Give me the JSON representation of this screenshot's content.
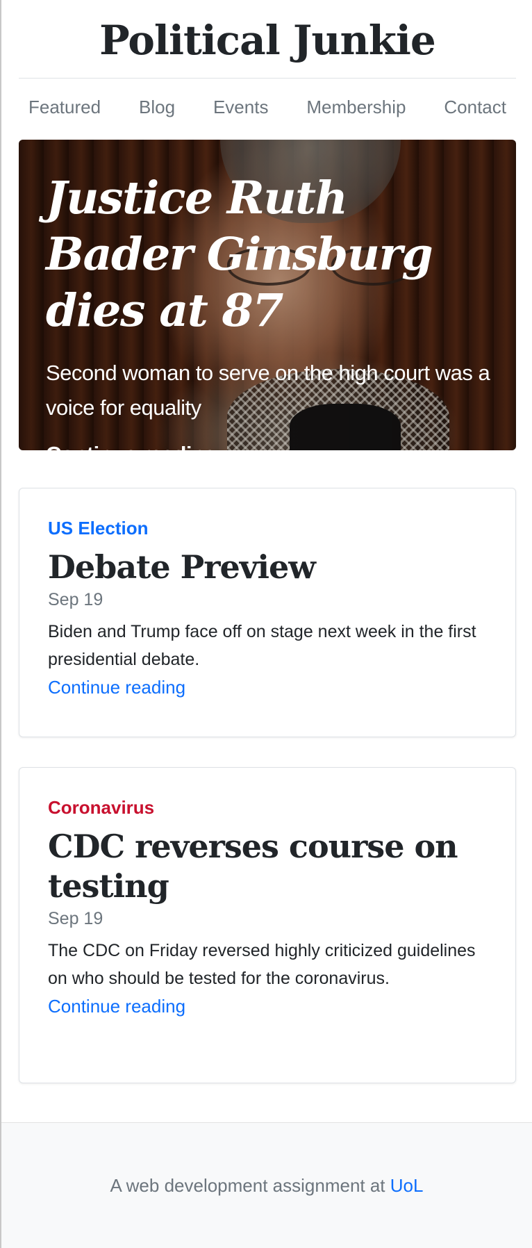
{
  "header": {
    "title": "Political Junkie"
  },
  "nav": {
    "items": [
      {
        "label": "Featured"
      },
      {
        "label": "Blog"
      },
      {
        "label": "Events"
      },
      {
        "label": "Membership"
      },
      {
        "label": "Contact"
      }
    ]
  },
  "hero": {
    "title": "Justice Ruth Bader Ginsburg dies at 87",
    "lead": "Second woman to serve on the high court was a voice for equality",
    "link": "Continue reading..."
  },
  "posts": [
    {
      "category": "US Election",
      "category_color": "#0d6efd",
      "title": "Debate Preview",
      "date": "Sep 19",
      "excerpt": "Biden and Trump face off on stage next week in the first presidential debate.",
      "link": "Continue reading"
    },
    {
      "category": "Coronavirus",
      "category_color": "#c8102e",
      "title": "CDC reverses course on testing",
      "date": "Sep 19",
      "excerpt": "The CDC on Friday reversed highly criticized guidelines on who should be tested for the coronavirus.",
      "link": "Continue reading"
    }
  ],
  "footer": {
    "text": "A web development assignment at ",
    "link": "UoL"
  }
}
